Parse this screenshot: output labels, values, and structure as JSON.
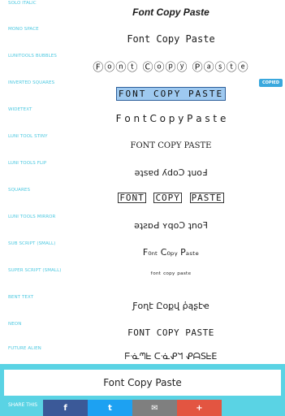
{
  "rows": [
    {
      "label": "SOLO ITALIC",
      "text": "Font Copy Paste"
    },
    {
      "label": "MONO SPACE",
      "text": "Font Copy Paste"
    },
    {
      "label": "LUNITOOLS BUBBLES",
      "text": "Ⓕⓞⓝⓣ Ⓒⓞⓟⓨ Ⓟⓐⓢⓣⓔ"
    },
    {
      "label": "INVERTED SQUARES",
      "text": "FONT COPY PASTE"
    },
    {
      "label": "WIDETEXT",
      "text": "F o n t   C o p y   P a s t e"
    },
    {
      "label": "LUNI TOOL STINY",
      "text": "FONT COPY PASTE"
    },
    {
      "label": "LUNI TOOLS FLIP",
      "text": "ǝʇsɐd ʎdoƆ ʇuoℲ"
    },
    {
      "label": "SQUARES",
      "text": [
        "FONT",
        "COPY",
        "PASTE"
      ]
    },
    {
      "label": "LUNI TOOLS MIRROR",
      "text": "ǝʇƨɒԀ ʏqoƆ ʇnoꟻ"
    },
    {
      "label": "SUB SCRIPT (SMALL)",
      "text": "F₀ₙₜ C₀ₚᵧ Pₐₛₜₑ"
    },
    {
      "label": "SUPER SCRIPT (SMALL)",
      "text": "ᶠᵒⁿᵗ ᶜᵒᵖʸ ᵖᵃˢᵗᵉ"
    },
    {
      "label": "BENT TEXT",
      "text": "Ƒօղէ Ըօքվ ῥąʂէҽ"
    },
    {
      "label": "NEON",
      "text": "FONT COPY PASTE"
    },
    {
      "label": "FUTURE ALIEN",
      "text": "ᖴᓍᘉᖶ ᑕᓍᕵᖻ ᕵᗩSᖶE"
    }
  ],
  "copied_label": "COPIED",
  "editor": {
    "value": "Font Copy Paste"
  },
  "share": {
    "label": "SHARE THIS",
    "buttons": [
      {
        "name": "facebook",
        "glyph": "f",
        "color": "#3b5998"
      },
      {
        "name": "twitter",
        "glyph": "t",
        "color": "#1da1f2"
      },
      {
        "name": "email",
        "glyph": "✉",
        "color": "#7f7f7f"
      },
      {
        "name": "google-plus",
        "glyph": "+",
        "color": "#e35541"
      }
    ]
  }
}
